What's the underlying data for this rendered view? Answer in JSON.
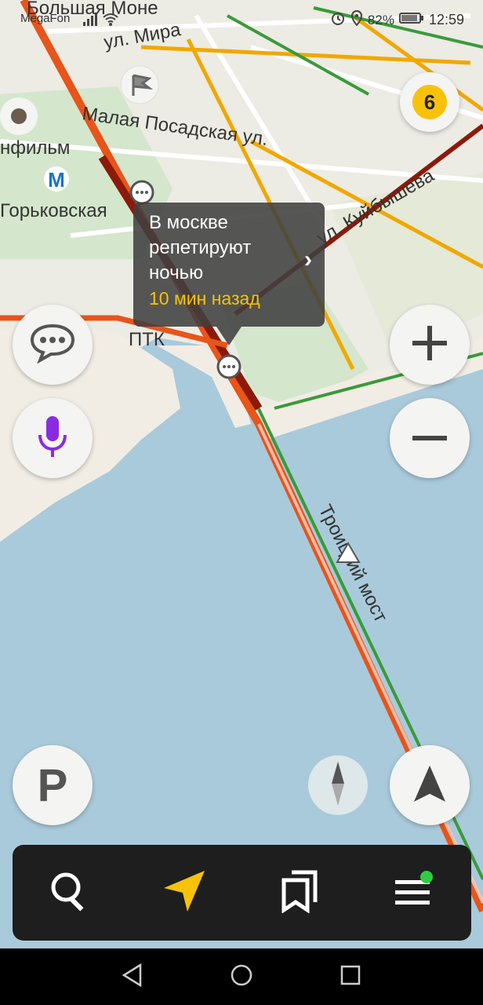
{
  "status_bar": {
    "carrier": "MegaFon",
    "battery": "82%",
    "time": "12:59"
  },
  "map": {
    "labels": {
      "bolshaya_monetnaya": "Большая Моне",
      "ul_mira": "ул. Мира",
      "malaya_posadskaya": "Малая Посадская ул.",
      "lenfilm": "нфильм",
      "gorkovskaya": "Горьковская",
      "ul_kuybysheva": "ул. Куйбышева",
      "ptk": "ПТК",
      "troitsky_most": "Троицкий мост"
    },
    "metro_symbol": "M"
  },
  "traffic": {
    "score": "6"
  },
  "event_popup": {
    "message": "В москве репетируют ночью",
    "time_ago": "10 мин назад"
  },
  "parking_button": {
    "label": "P"
  },
  "icons": {
    "search": "search-icon",
    "navigator": "navigation-arrow-icon",
    "bookmarks": "bookmarks-icon",
    "menu": "menu-icon",
    "voice": "microphone-icon",
    "chat": "chat-bubble-icon",
    "compass": "compass-icon",
    "location": "my-location-arrow-icon"
  },
  "colors": {
    "traffic_red": "#e8541a",
    "traffic_darkred": "#8b1a0a",
    "traffic_yellow": "#f0a800",
    "traffic_green": "#3a9a3a",
    "water": "#a9cadb",
    "accent_yellow": "#f8c20a",
    "voice_purple": "#8a2be2"
  }
}
